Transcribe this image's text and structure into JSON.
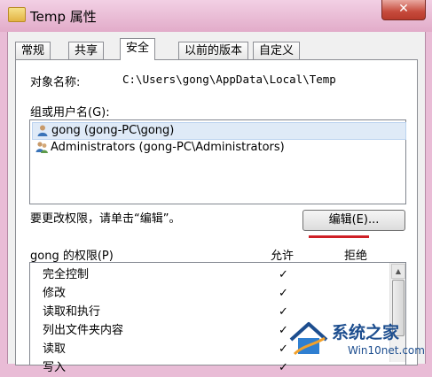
{
  "window": {
    "title": "Temp 属性",
    "close": "✕"
  },
  "tabs": [
    {
      "label": "常规"
    },
    {
      "label": "共享"
    },
    {
      "label": "安全"
    },
    {
      "label": "以前的版本"
    },
    {
      "label": "自定义"
    }
  ],
  "object": {
    "label": "对象名称:",
    "value": "C:\\Users\\gong\\AppData\\Local\\Temp"
  },
  "groups": {
    "label": "组或用户名(G):",
    "items": [
      {
        "text": "gong (gong-PC\\gong)",
        "icon": "user-icon"
      },
      {
        "text": "Administrators (gong-PC\\Administrators)",
        "icon": "users-group-icon"
      }
    ]
  },
  "change_hint": "要更改权限，请单击“编辑”。",
  "edit_button": "编辑(E)...",
  "permissions": {
    "label": "gong 的权限(P)",
    "allow": "允许",
    "deny": "拒绝",
    "items": [
      {
        "name": "完全控制",
        "allow": "✓"
      },
      {
        "name": "修改",
        "allow": "✓"
      },
      {
        "name": "读取和执行",
        "allow": "✓"
      },
      {
        "name": "列出文件夹内容",
        "allow": "✓"
      },
      {
        "name": "读取",
        "allow": "✓"
      },
      {
        "name": "写入",
        "allow": "✓"
      }
    ]
  },
  "watermark": {
    "brand": "系统之家",
    "url": "Win10net.com"
  },
  "colors": {
    "window_frame": "#e9bcd6",
    "accent_underline": "#cf2026",
    "watermark": "#1d4e8f"
  }
}
